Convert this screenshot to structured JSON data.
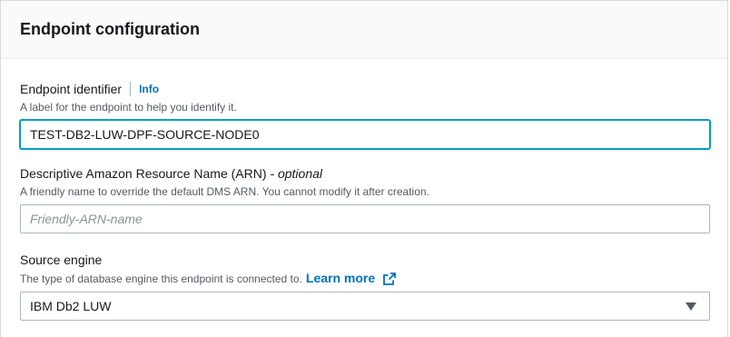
{
  "panel": {
    "title": "Endpoint configuration"
  },
  "endpoint_identifier": {
    "label": "Endpoint identifier",
    "info_link": "Info",
    "description": "A label for the endpoint to help you identify it.",
    "value": "TEST-DB2-LUW-DPF-SOURCE-NODE0"
  },
  "arn": {
    "label": "Descriptive Amazon Resource Name (ARN)",
    "optional_suffix": " - optional",
    "description": "A friendly name to override the default DMS ARN. You cannot modify it after creation.",
    "placeholder": "Friendly-ARN-name",
    "value": ""
  },
  "source_engine": {
    "label": "Source engine",
    "description": "The type of database engine this endpoint is connected to.",
    "learn_more": "Learn more",
    "selected": "IBM Db2 LUW"
  },
  "colors": {
    "link": "#0073bb",
    "focus_border": "#00a1c9",
    "text": "#16191f",
    "muted": "#545b64",
    "header_bg": "#fafafa"
  },
  "icons": {
    "external_link": "external-link-icon",
    "dropdown": "caret-down-icon"
  }
}
